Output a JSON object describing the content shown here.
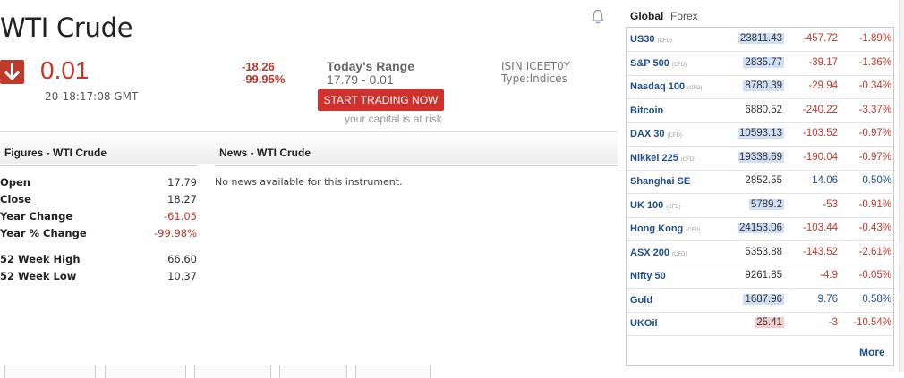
{
  "instrument": {
    "title": "WTI Crude",
    "price": "0.01",
    "timestamp": "20-18:17:08 GMT",
    "change": "-18.26",
    "change_pct": "-99.95%",
    "range_label": "Today's Range",
    "range_value": "17.79 - 0.01",
    "isin": "ISIN:ICEET0Y",
    "type": "Type:Indices",
    "trade_button": "START TRADING NOW",
    "risk_note": "your capital is at risk",
    "direction_icon": "down-arrow-icon",
    "alert_icon": "bell-icon"
  },
  "figures": {
    "heading": "Figures - WTI Crude",
    "rows": [
      {
        "label": "Open",
        "value": "17.79"
      },
      {
        "label": "Close",
        "value": "18.27"
      },
      {
        "label": "Year Change",
        "value": "-61.05"
      },
      {
        "label": "Year % Change",
        "value": "-99.98%"
      },
      {
        "label": "52 Week High",
        "value": "66.60"
      },
      {
        "label": "52 Week Low",
        "value": "10.37"
      }
    ]
  },
  "news": {
    "heading": "News - WTI Crude",
    "empty_text": "No news available for this instrument."
  },
  "markets": {
    "tabs": [
      "Global",
      "Forex"
    ],
    "cfd_tag": "(CFD)",
    "rows": [
      {
        "name": "US30",
        "cfd": true,
        "price": "23811.43",
        "change": "-457.72",
        "pct": "-1.89%"
      },
      {
        "name": "S&P 500",
        "cfd": true,
        "price": "2835.77",
        "change": "-39.17",
        "pct": "-1.36%"
      },
      {
        "name": "Nasdaq 100",
        "cfd": true,
        "price": "8780.39",
        "change": "-29.94",
        "pct": "-0.34%"
      },
      {
        "name": "Bitcoin",
        "cfd": false,
        "price": "6880.52",
        "change": "-240.22",
        "pct": "-3.37%"
      },
      {
        "name": "DAX 30",
        "cfd": true,
        "price": "10593.13",
        "change": "-103.52",
        "pct": "-0.97%"
      },
      {
        "name": "Nikkei 225",
        "cfd": true,
        "price": "19338.69",
        "change": "-190.04",
        "pct": "-0.97%"
      },
      {
        "name": "Shanghai SE",
        "cfd": false,
        "price": "2852.55",
        "change": "14.06",
        "pct": "0.50%"
      },
      {
        "name": "UK 100",
        "cfd": true,
        "price": "5789.2",
        "change": "-53",
        "pct": "-0.91%"
      },
      {
        "name": "Hong Kong",
        "cfd": true,
        "price": "24153.06",
        "change": "-103.44",
        "pct": "-0.43%"
      },
      {
        "name": "ASX 200",
        "cfd": true,
        "price": "5353.88",
        "change": "-143.52",
        "pct": "-2.61%"
      },
      {
        "name": "Nifty 50",
        "cfd": false,
        "price": "9261.85",
        "change": "-4.9",
        "pct": "-0.05%"
      },
      {
        "name": "Gold",
        "cfd": false,
        "price": "1687.96",
        "change": "9.76",
        "pct": "0.58%"
      },
      {
        "name": "UKOil",
        "cfd": false,
        "price": "25.41",
        "change": "-3",
        "pct": "-10.54%"
      }
    ],
    "more_label": "More"
  },
  "colors": {
    "negative": "#c0392b",
    "positive": "#1f4e8f",
    "highlight_up": "#cfdff5",
    "highlight_down": "#f8cccc"
  }
}
